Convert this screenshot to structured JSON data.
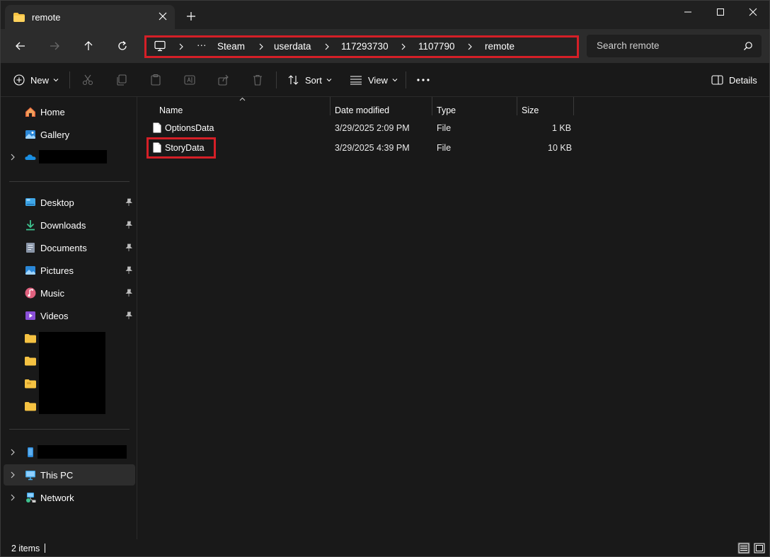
{
  "window": {
    "tab_title": "remote",
    "minimize_icon": "minimize-icon",
    "maximize_icon": "maximize-icon",
    "close_icon": "close-icon"
  },
  "address": {
    "breadcrumbs": [
      "Steam",
      "userdata",
      "117293730",
      "1107790",
      "remote"
    ],
    "overflow": "···"
  },
  "search": {
    "placeholder": "Search remote"
  },
  "commands": {
    "new_label": "New",
    "sort_label": "Sort",
    "view_label": "View",
    "more_label": "···",
    "details_label": "Details"
  },
  "sidebar": {
    "home": "Home",
    "gallery": "Gallery",
    "quick_access": [
      {
        "label": "Desktop"
      },
      {
        "label": "Downloads"
      },
      {
        "label": "Documents"
      },
      {
        "label": "Pictures"
      },
      {
        "label": "Music"
      },
      {
        "label": "Videos"
      }
    ],
    "this_pc": "This PC",
    "network": "Network"
  },
  "columns": {
    "name": "Name",
    "date_modified": "Date modified",
    "type": "Type",
    "size": "Size"
  },
  "files": [
    {
      "name": "OptionsData",
      "date": "3/29/2025 2:09 PM",
      "type": "File",
      "size": "1 KB"
    },
    {
      "name": "StoryData",
      "date": "3/29/2025 4:39 PM",
      "type": "File",
      "size": "10 KB"
    }
  ],
  "status": {
    "item_count": "2 items"
  },
  "colors": {
    "accent_highlight": "#d51f27",
    "background": "#191919",
    "toolbar": "#2c2c2c",
    "folder": "#f5c242"
  }
}
